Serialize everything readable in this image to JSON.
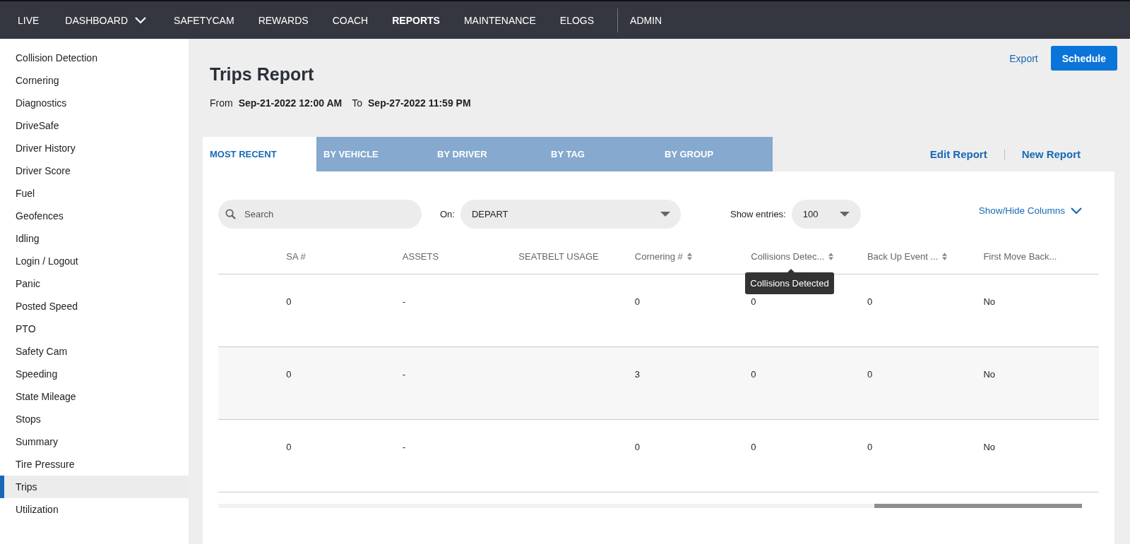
{
  "nav": {
    "items": [
      {
        "label": "LIVE",
        "kind": "link",
        "selected": false
      },
      {
        "label": "DASHBOARD",
        "kind": "dropdown",
        "selected": false
      },
      {
        "label": "SAFETYCAM",
        "kind": "link",
        "selected": false
      },
      {
        "label": "REWARDS",
        "kind": "link",
        "selected": false
      },
      {
        "label": "COACH",
        "kind": "link",
        "selected": false
      },
      {
        "label": "REPORTS",
        "kind": "link",
        "selected": true
      },
      {
        "label": "MAINTENANCE",
        "kind": "link",
        "selected": false
      },
      {
        "label": "ELOGS",
        "kind": "link",
        "selected": false
      }
    ],
    "admin": {
      "label": "ADMIN",
      "selected": false
    }
  },
  "sidebar": {
    "items": [
      {
        "label": "Collision Detection",
        "selected": false
      },
      {
        "label": "Cornering",
        "selected": false
      },
      {
        "label": "Diagnostics",
        "selected": false
      },
      {
        "label": "DriveSafe",
        "selected": false
      },
      {
        "label": "Driver History",
        "selected": false
      },
      {
        "label": "Driver Score",
        "selected": false
      },
      {
        "label": "Fuel",
        "selected": false
      },
      {
        "label": "Geofences",
        "selected": false
      },
      {
        "label": "Idling",
        "selected": false
      },
      {
        "label": "Login / Logout",
        "selected": false
      },
      {
        "label": "Panic",
        "selected": false
      },
      {
        "label": "Posted Speed",
        "selected": false
      },
      {
        "label": "PTO",
        "selected": false
      },
      {
        "label": "Safety Cam",
        "selected": false
      },
      {
        "label": "Speeding",
        "selected": false
      },
      {
        "label": "State Mileage",
        "selected": false
      },
      {
        "label": "Stops",
        "selected": false
      },
      {
        "label": "Summary",
        "selected": false
      },
      {
        "label": "Tire Pressure",
        "selected": false
      },
      {
        "label": "Trips",
        "selected": true
      },
      {
        "label": "Utilization",
        "selected": false
      }
    ]
  },
  "header": {
    "title": "Trips Report",
    "from_label": "From",
    "from_value": "Sep-21-2022 12:00 AM",
    "to_label": "To",
    "to_value": "Sep-27-2022 11:59 PM",
    "export": "Export",
    "schedule": "Schedule"
  },
  "tabs": [
    {
      "label": "MOST RECENT",
      "selected": true
    },
    {
      "label": "BY VEHICLE",
      "selected": false
    },
    {
      "label": "BY DRIVER",
      "selected": false
    },
    {
      "label": "BY TAG",
      "selected": false
    },
    {
      "label": "BY GROUP",
      "selected": false
    }
  ],
  "report_links": [
    "Edit Report",
    "New Report"
  ],
  "filters": {
    "search_placeholder": "Search",
    "on_label": "On:",
    "on_value": "DEPART",
    "entries_label": "Show entries:",
    "entries_value": "100",
    "columns_toggle": "Show/Hide Columns"
  },
  "table": {
    "columns": [
      {
        "label": "SA #",
        "sortable": false
      },
      {
        "label": "ASSETS",
        "sortable": false
      },
      {
        "label": "SEATBELT USAGE",
        "sortable": false
      },
      {
        "label": "Cornering #",
        "sortable": true
      },
      {
        "label": "Collisions Detec...",
        "sortable": true,
        "tooltip": "Collisions Detected"
      },
      {
        "label": "Back Up Event ...",
        "sortable": true
      },
      {
        "label": "First Move Back...",
        "sortable": false
      }
    ],
    "rows": [
      [
        "0",
        "-",
        "",
        "0",
        "0",
        "0",
        "No"
      ],
      [
        "0",
        "-",
        "",
        "3",
        "0",
        "0",
        "No"
      ],
      [
        "0",
        "-",
        "",
        "0",
        "0",
        "0",
        "No"
      ]
    ]
  }
}
